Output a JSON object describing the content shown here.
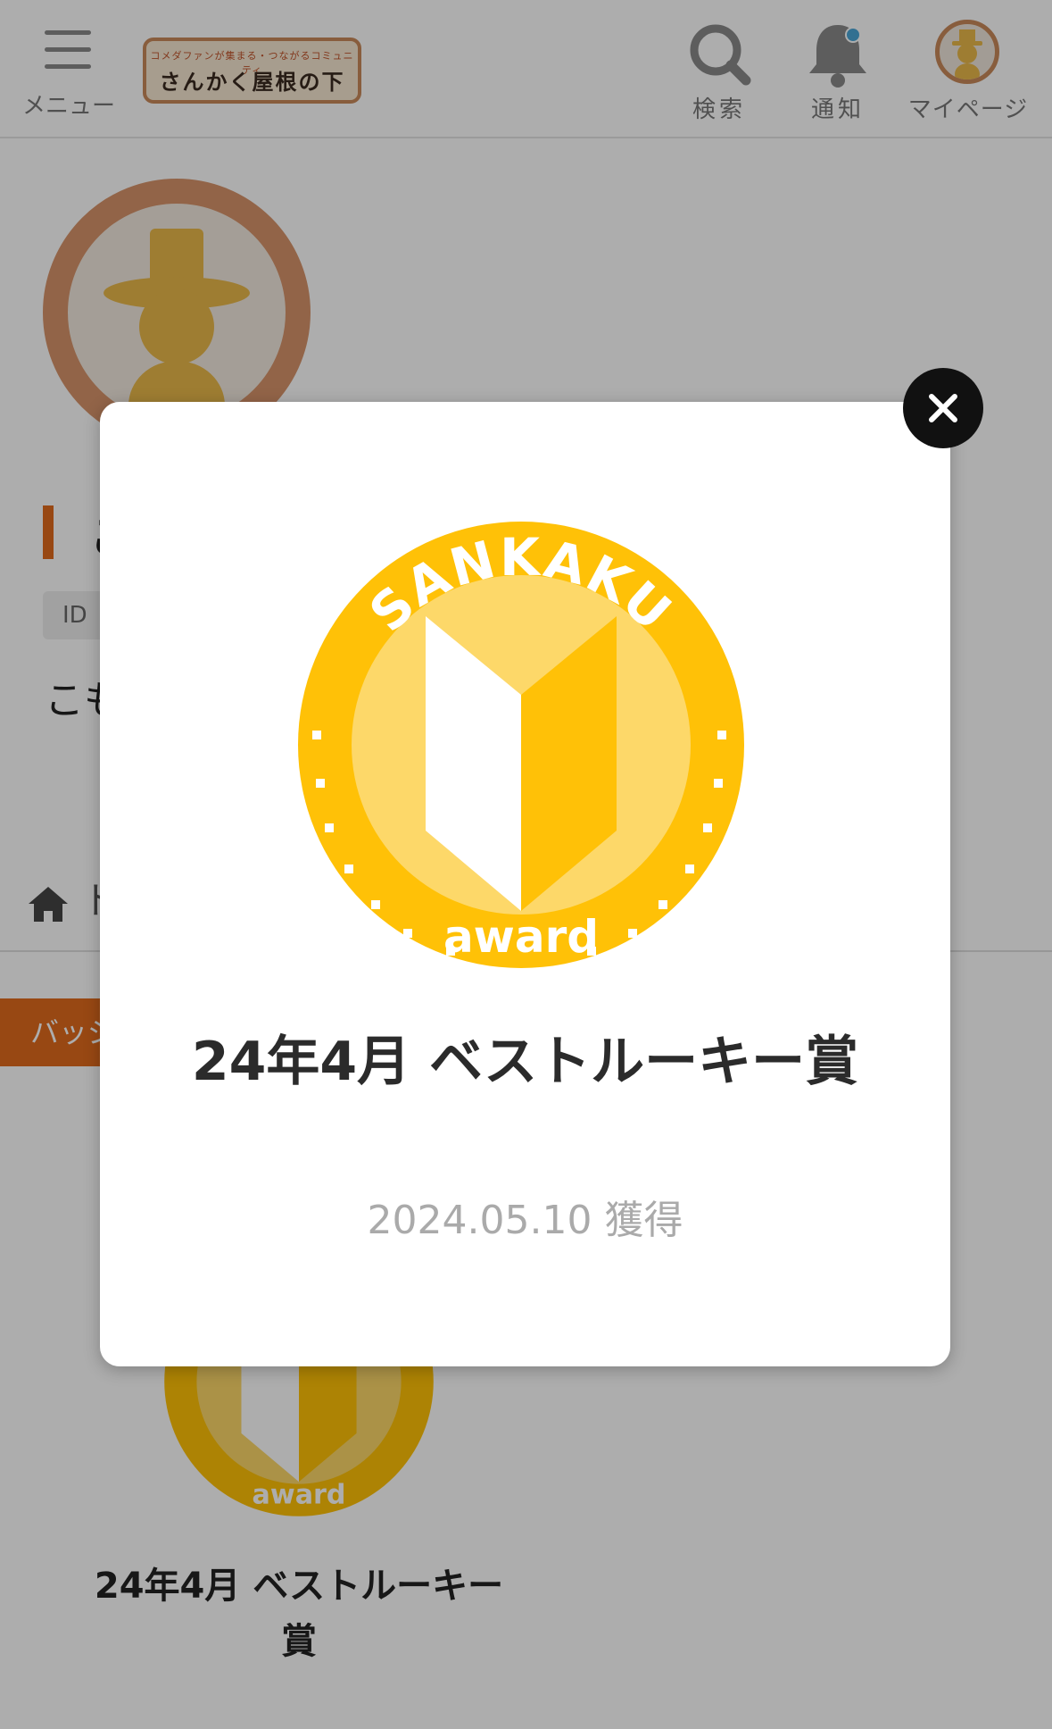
{
  "header": {
    "menu_label": "メニュー",
    "logo_tagline": "コメダファンが集まる・つながるコミュニティ",
    "logo_title": "さんかく屋根の下",
    "search_label": "検索",
    "notify_label": "通知",
    "mypage_label": "マイページ"
  },
  "profile": {
    "name_initial": "こ",
    "id_label": "ID",
    "bio_initial": "こも"
  },
  "tabs": {
    "home_label": "ト",
    "badge_label": "バッジ"
  },
  "badge_list": {
    "item_title": "24年4月 ベストルーキー賞",
    "badge_top_text": "SANKAKU",
    "badge_bottom_text": "award"
  },
  "modal": {
    "badge_top_text": "SANKAKU",
    "badge_bottom_text": "award",
    "title": "24年4月 ベストルーキー賞",
    "acquired_date": "2024.05.10 獲得"
  },
  "colors": {
    "accent": "#e06a1c",
    "badge_gold": "#ffc107",
    "badge_light": "#fdd869",
    "overlay": "rgba(0,0,0,0.32)"
  }
}
